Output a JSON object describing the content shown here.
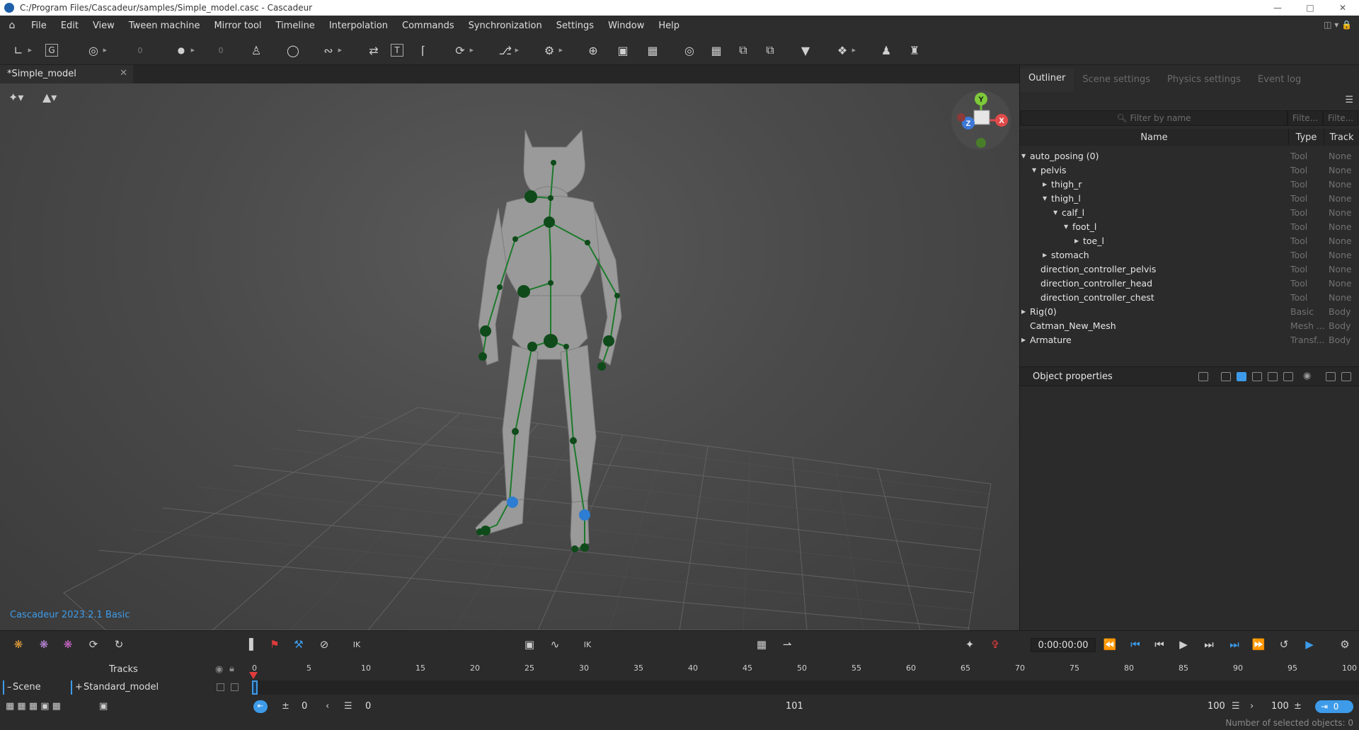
{
  "window": {
    "title": "C:/Program Files/Cascadeur/samples/Simple_model.casc - Cascadeur"
  },
  "menu": [
    "File",
    "Edit",
    "View",
    "Tween machine",
    "Mirror tool",
    "Timeline",
    "Interpolation",
    "Commands",
    "Synchronization",
    "Settings",
    "Window",
    "Help"
  ],
  "toolbar": {
    "number_a": "0",
    "number_b": "0",
    "letter_g": "G",
    "letter_t": "T"
  },
  "document_tab": {
    "label": "*Simple_model",
    "close": "✕"
  },
  "viewport": {
    "version_label": "Cascadeur 2023.2.1 Basic",
    "gizmo": {
      "y": "Y",
      "x": "X",
      "z": "Z"
    }
  },
  "panel": {
    "tabs": [
      "Outliner",
      "Scene settings",
      "Physics settings",
      "Event log"
    ],
    "active_tab": "Outliner",
    "filter_placeholder": "Filter by name",
    "filter_type_placeholder": "Filte...",
    "filter_track_placeholder": "Filte...",
    "columns": {
      "name": "Name",
      "type": "Type",
      "track": "Track"
    },
    "tree": [
      {
        "name": "auto_posing (0)",
        "type": "Tool",
        "track": "None",
        "depth": 0,
        "arrow": "expanded"
      },
      {
        "name": "pelvis",
        "type": "Tool",
        "track": "None",
        "depth": 1,
        "arrow": "expanded"
      },
      {
        "name": "thigh_r",
        "type": "Tool",
        "track": "None",
        "depth": 2,
        "arrow": "collapsed"
      },
      {
        "name": "thigh_l",
        "type": "Tool",
        "track": "None",
        "depth": 2,
        "arrow": "expanded"
      },
      {
        "name": "calf_l",
        "type": "Tool",
        "track": "None",
        "depth": 3,
        "arrow": "expanded"
      },
      {
        "name": "foot_l",
        "type": "Tool",
        "track": "None",
        "depth": 4,
        "arrow": "expanded"
      },
      {
        "name": "toe_l",
        "type": "Tool",
        "track": "None",
        "depth": 5,
        "arrow": "collapsed"
      },
      {
        "name": "stomach",
        "type": "Tool",
        "track": "None",
        "depth": 2,
        "arrow": "collapsed"
      },
      {
        "name": "direction_controller_pelvis",
        "type": "Tool",
        "track": "None",
        "depth": 1,
        "arrow": "none"
      },
      {
        "name": "direction_controller_head",
        "type": "Tool",
        "track": "None",
        "depth": 1,
        "arrow": "none"
      },
      {
        "name": "direction_controller_chest",
        "type": "Tool",
        "track": "None",
        "depth": 1,
        "arrow": "none"
      },
      {
        "name": "Rig(0)",
        "type": "Basic",
        "track": "Body",
        "depth": 0,
        "arrow": "collapsed"
      },
      {
        "name": "Catman_New_Mesh",
        "type": "Mesh ...",
        "track": "Body",
        "depth": 0,
        "arrow": "none"
      },
      {
        "name": "Armature",
        "type": "Transf...",
        "track": "Body",
        "depth": 0,
        "arrow": "collapsed"
      }
    ],
    "object_properties": "Object properties"
  },
  "timeline": {
    "time": "0:00:00:00",
    "tracks_label": "Tracks",
    "scene_label": "Scene",
    "scene_prefix": "–",
    "model_label": "Standard_model",
    "model_prefix": "+",
    "ruler": [
      "0",
      "5",
      "10",
      "15",
      "20",
      "25",
      "30",
      "35",
      "40",
      "45",
      "50",
      "55",
      "60",
      "65",
      "70",
      "75",
      "80",
      "85",
      "90",
      "95",
      "100"
    ],
    "start_frame": "0",
    "interval_frame": "0",
    "middle_value": "101",
    "end_frame": "100",
    "end_frame2": "100",
    "current_frame": "0",
    "ik_label": "IK",
    "selected_status": "Number of selected objects: 0"
  },
  "colors": {
    "accent": "#3d9be9",
    "joint": "#0f4a1a",
    "bone": "#1c7a2b",
    "blue_joint": "#2d7dd2",
    "playhead": "#e03b3b"
  }
}
